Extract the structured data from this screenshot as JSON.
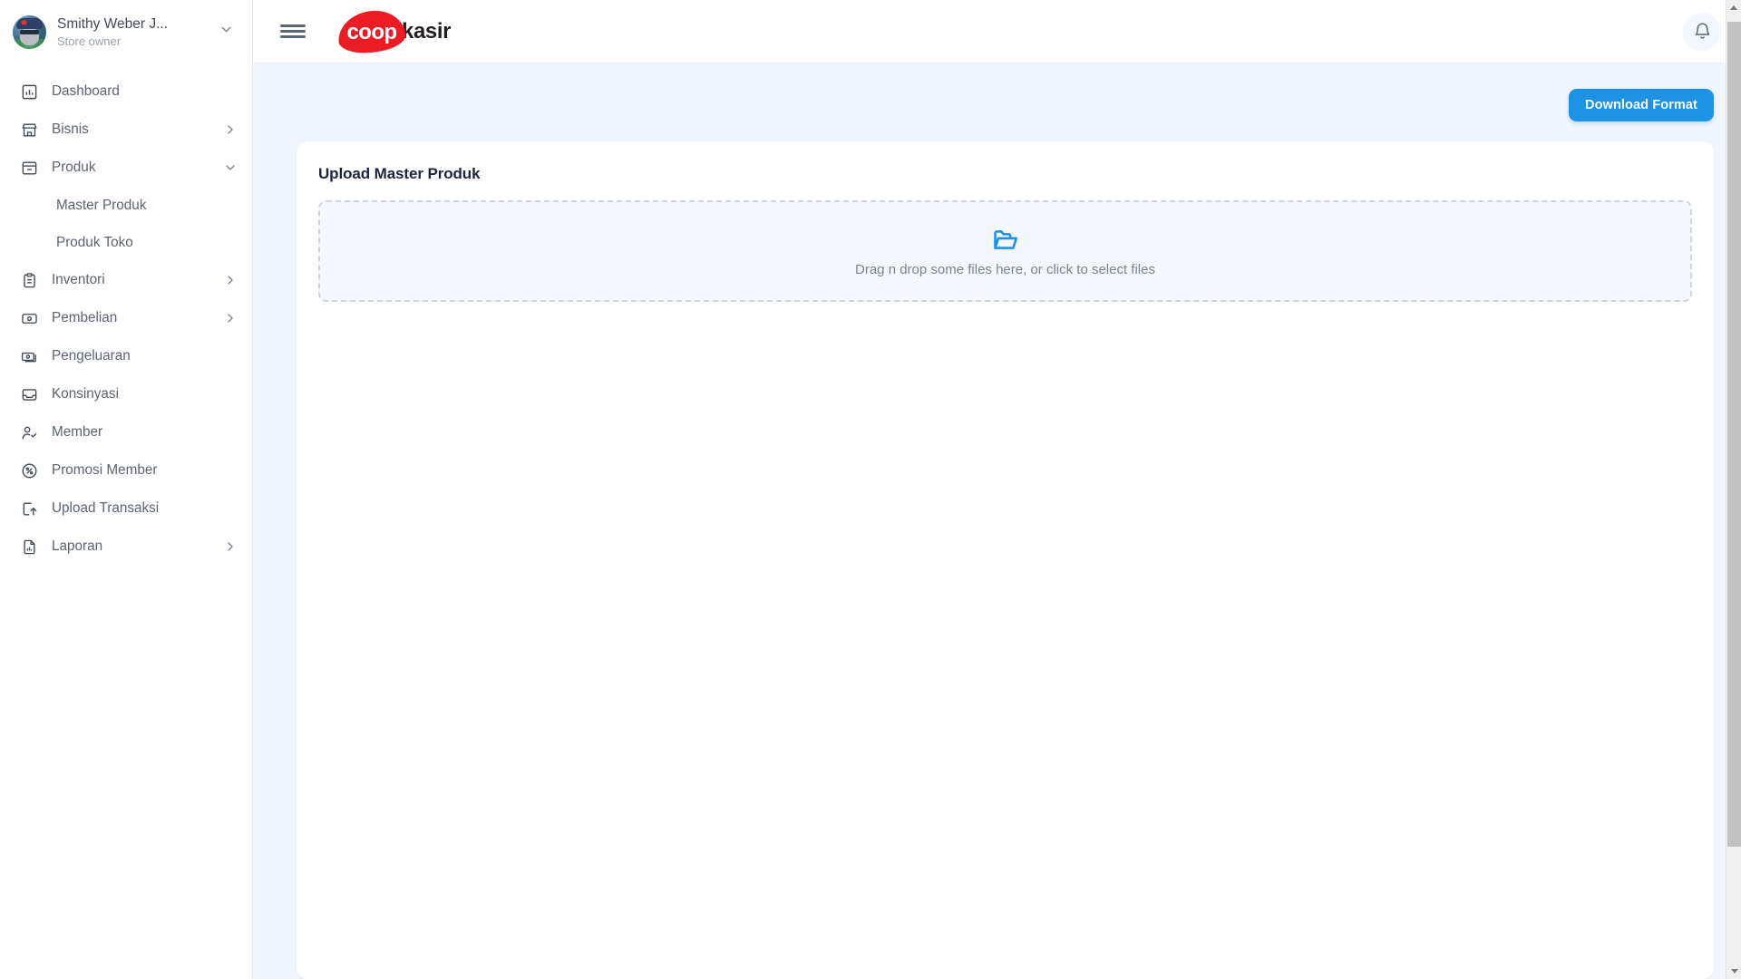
{
  "sidebar": {
    "profile": {
      "name": "Smithy Weber J...",
      "role": "Store owner",
      "avatar_icon": "user-avatar",
      "caret_icon": "chevron-down-icon"
    },
    "items": [
      {
        "label": "Dashboard",
        "icon": "bar-chart-icon",
        "expandable": false
      },
      {
        "label": "Bisnis",
        "icon": "store-icon",
        "expandable": true,
        "chevron": "chevron-right-icon"
      },
      {
        "label": "Produk",
        "icon": "archive-box-icon",
        "expandable": true,
        "chevron": "chevron-down-icon",
        "expanded": true
      },
      {
        "label": "Inventori",
        "icon": "clipboard-list-icon",
        "expandable": true,
        "chevron": "chevron-right-icon"
      },
      {
        "label": "Pembelian",
        "icon": "money-note-icon",
        "expandable": true,
        "chevron": "chevron-right-icon"
      },
      {
        "label": "Pengeluaran",
        "icon": "banknotes-icon",
        "expandable": false
      },
      {
        "label": "Konsinyasi",
        "icon": "inbox-icon",
        "expandable": false
      },
      {
        "label": "Member",
        "icon": "user-check-icon",
        "expandable": false
      },
      {
        "label": "Promosi Member",
        "icon": "percent-circle-icon",
        "expandable": false
      },
      {
        "label": "Upload Transaksi",
        "icon": "file-upload-icon",
        "expandable": false
      },
      {
        "label": "Laporan",
        "icon": "file-chart-icon",
        "expandable": true,
        "chevron": "chevron-right-icon"
      }
    ],
    "subitems": [
      {
        "label": "Master Produk"
      },
      {
        "label": "Produk Toko"
      }
    ]
  },
  "topbar": {
    "menu_icon": "hamburger-menu-icon",
    "logo_primary": "coop",
    "logo_secondary": "kasir",
    "bell_icon": "notification-bell-icon"
  },
  "main": {
    "download_button": "Download Format",
    "card_title": "Upload Master Produk",
    "dropzone": {
      "icon": "open-folder-icon",
      "text": "Drag n drop some files here, or click to select files"
    }
  },
  "colors": {
    "accent_blue": "#1f93e3",
    "logo_red": "#ec1c24",
    "content_bg": "#f1f5fd",
    "dropzone_bg": "#f4f7fc",
    "title_navy": "#1b2540"
  }
}
